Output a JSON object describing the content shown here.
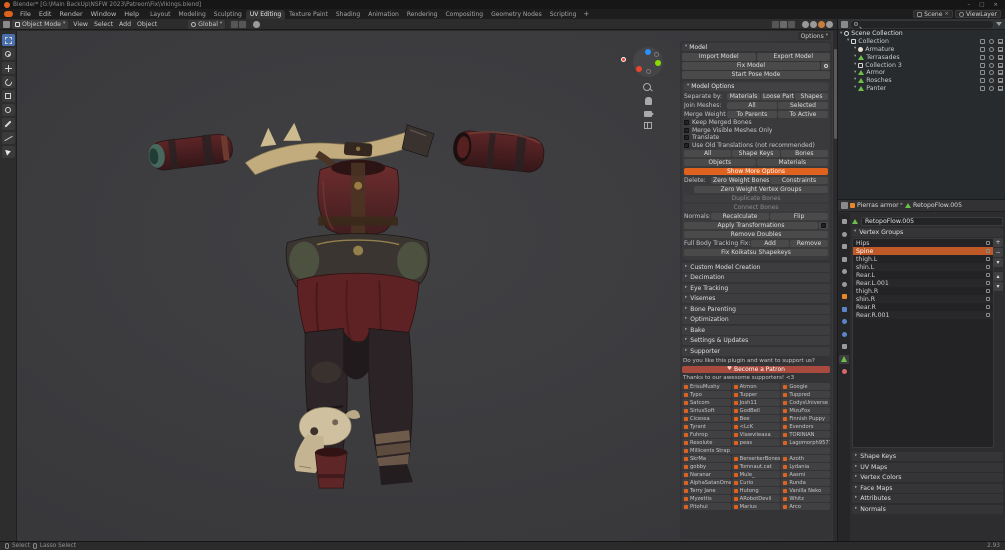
{
  "colors": {
    "accent": "#e0621f",
    "patron": "#a84a3e",
    "selected": "#bf5a28",
    "vp1": "#414144",
    "vp2": "#38383a"
  },
  "icons": {
    "chevron_down": "▾",
    "chevron_right": "▸",
    "chevron_up": "▴",
    "plus": "+",
    "minus": "−",
    "close": "×",
    "minimize": "–",
    "maximize": "□",
    "heart": "♥"
  },
  "titlebar": {
    "title": "Blender*  [G:\\Main BackUp\\NSFW 2023\\Patreon\\Fix\\Vikings.blend]"
  },
  "menubar": {
    "menus": [
      "File",
      "Edit",
      "Render",
      "Window",
      "Help"
    ],
    "workspaces": [
      {
        "label": "Layout"
      },
      {
        "label": "Modeling"
      },
      {
        "label": "Sculpting"
      },
      {
        "label": "UV Editing",
        "active": true
      },
      {
        "label": "Texture Paint"
      },
      {
        "label": "Shading"
      },
      {
        "label": "Animation"
      },
      {
        "label": "Rendering"
      },
      {
        "label": "Compositing"
      },
      {
        "label": "Geometry Nodes"
      },
      {
        "label": "Scripting"
      }
    ],
    "scene": "Scene",
    "viewlayer": "ViewLayer"
  },
  "viewport_header": {
    "mode": "Object Mode",
    "menus": [
      "View",
      "Select",
      "Add",
      "Object"
    ],
    "orientation": "Global",
    "options": "Options"
  },
  "cats": {
    "title": "Model",
    "import_btn": "Import Model",
    "export_btn": "Export Model",
    "fix_btn": "Fix Model",
    "pose_btn": "Start Pose Mode",
    "options_title": "Model Options",
    "separate_label": "Separate by:",
    "separate_buttons": [
      "Materials",
      "Loose Parts",
      "Shapes"
    ],
    "join_label": "Join Meshes:",
    "join_buttons": [
      "All",
      "Selected"
    ],
    "merge_label": "Merge Weights:",
    "merge_buttons": [
      "To Parents",
      "To Active"
    ],
    "checkboxes": [
      "Keep Merged Bones",
      "Merge Visible Meshes Only",
      "Translate",
      "Use Old Translations (not recommended)"
    ],
    "translate_row1": [
      "All",
      "Shape Keys",
      "Bones"
    ],
    "translate_row2": [
      "Objects",
      "Materials"
    ],
    "show_more_btn": "Show More Options",
    "delete_label": "Delete:",
    "delete_buttons": [
      "Zero Weight Bones",
      "Constraints"
    ],
    "delete_wide_btn": "Zero Weight Vertex Groups",
    "disabled_buttons": [
      "Duplicate Bones",
      "Connect Bones"
    ],
    "normals_label": "Normals:",
    "normals_buttons": [
      "Recalculate",
      "Flip"
    ],
    "apply_btn": "Apply Transformations",
    "remove_doubles_btn": "Remove Doubles",
    "fbt_label": "Full Body Tracking Fix:",
    "fbt_buttons": [
      "Add",
      "Remove"
    ],
    "koikatsu_btn": "Fix Koikatsu Shapekeys",
    "sections": [
      "Custom Model Creation",
      "Decimation",
      "Eye Tracking",
      "Visemes",
      "Bone Parenting",
      "Optimization",
      "Bake",
      "Settings & Updates",
      "Supporter"
    ],
    "support_question": "Do you like this plugin and want to support us?",
    "patron_btn": "Become a Patron",
    "thanks": "Thanks to our awesome supporters! <3",
    "supporters_a": [
      "ErisuMushy",
      "Atmon",
      "Google",
      "Typo",
      "Tupper",
      "Tuppred",
      "Satcom",
      "Josh11",
      "CodysUniverse",
      "SiriusSoft",
      "GodBell",
      "MizuFox",
      "Cicessa",
      "Bee",
      "Finnish Puppy",
      "Tyrant",
      "<LcK",
      "Evendors",
      "Fuhrop",
      "Vlawviieaxa",
      "TORINIAN",
      "Resolute",
      "peas",
      "Lagomorph9577"
    ],
    "supporter_wide": "Millicents Strap",
    "supporters_b": [
      "SkrMa",
      "BerserkerBones",
      "Azoth",
      "gobby",
      "Tomnaut.cat",
      "Lydania",
      "Naranar",
      "Mule_",
      "Aasmi",
      "AlphaSatanOmega",
      "Curio",
      "Runda",
      "Terry Jane",
      "Hutong",
      "Vanilla Neko",
      "Myzettis",
      "ARobotDevil",
      "Whitz",
      "Pitohui",
      "Marius",
      "Arco"
    ]
  },
  "outliner": {
    "root": "Scene Collection",
    "items": [
      {
        "name": "Collection",
        "cls": "collection",
        "level": 1
      },
      {
        "name": "Armature",
        "cls": "armature",
        "level": 2
      },
      {
        "name": "Terrasades",
        "cls": "mesh",
        "level": 2
      },
      {
        "name": "Collection 3",
        "cls": "collection",
        "level": 2
      },
      {
        "name": "Armor",
        "cls": "mesh",
        "level": 2
      },
      {
        "name": "Rosches",
        "cls": "mesh",
        "level": 2
      },
      {
        "name": "Panter",
        "cls": "mesh",
        "level": 2
      }
    ]
  },
  "properties": {
    "breadcrumb": [
      "Pierras armor",
      "RetopoFlow.005"
    ],
    "name_value": "RetopoFlow.005",
    "vertex_groups_label": "Vertex Groups",
    "groups": [
      {
        "name": "Hips"
      },
      {
        "name": "Spine",
        "active": true
      },
      {
        "name": "thigh.L"
      },
      {
        "name": "shin.L"
      },
      {
        "name": "Rear.L"
      },
      {
        "name": "Rear.L.001"
      },
      {
        "name": "thigh.R"
      },
      {
        "name": "shin.R"
      },
      {
        "name": "Rear.R"
      },
      {
        "name": "Rear.R.001"
      }
    ],
    "panels": [
      "Shape Keys",
      "UV Maps",
      "Vertex Colors",
      "Face Maps",
      "Attributes",
      "Normals"
    ]
  },
  "statusbar": {
    "left_a": "Select",
    "left_b": "Lasso Select",
    "right": "2.93"
  }
}
